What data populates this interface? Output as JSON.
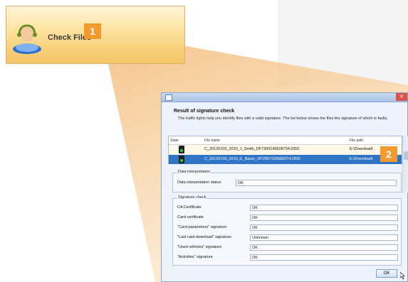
{
  "toolbar": {
    "check_files_label": "Check Files",
    "callout_1": "1",
    "callout_2": "2"
  },
  "dialog": {
    "title": "Result of signature check",
    "description": "The traffic lights help you identify files with a valid signature. The list below shows the files the signature of which is faulty.",
    "close_icon": "close-icon",
    "columns": {
      "state": "State",
      "file_name": "File name",
      "file_path": "File path"
    },
    "files": [
      {
        "name": "C_20120105_2010_J_Smith_DF7359145628734.DDD",
        "path": "E:\\Download\\",
        "state": "green"
      },
      {
        "name": "C_20120130_2010_E_Bauer_DF3957103568274.DDD",
        "path": "E:\\Download\\",
        "state": "green"
      }
    ],
    "data_interpretation": {
      "legend": "Data interpretation",
      "status_label": "Data interpretation status",
      "status_value": "OK"
    },
    "signature_check": {
      "legend": "Signature check",
      "rows": [
        {
          "label": "CA Certificate",
          "value": "OK"
        },
        {
          "label": "Card certificate",
          "value": "OK"
        },
        {
          "label": "\"Card parameters\" signature",
          "value": "OK"
        },
        {
          "label": "\"Last card download\" signature",
          "value": "Unknown"
        },
        {
          "label": "\"Used vehicles\" signature",
          "value": "OK"
        },
        {
          "label": "\"Activities\" signature",
          "value": "OK"
        }
      ]
    },
    "ok_label": "OK"
  },
  "colors": {
    "accent": "#f29a2e",
    "selection": "#2f74c5",
    "beam": "#f6c98f"
  }
}
